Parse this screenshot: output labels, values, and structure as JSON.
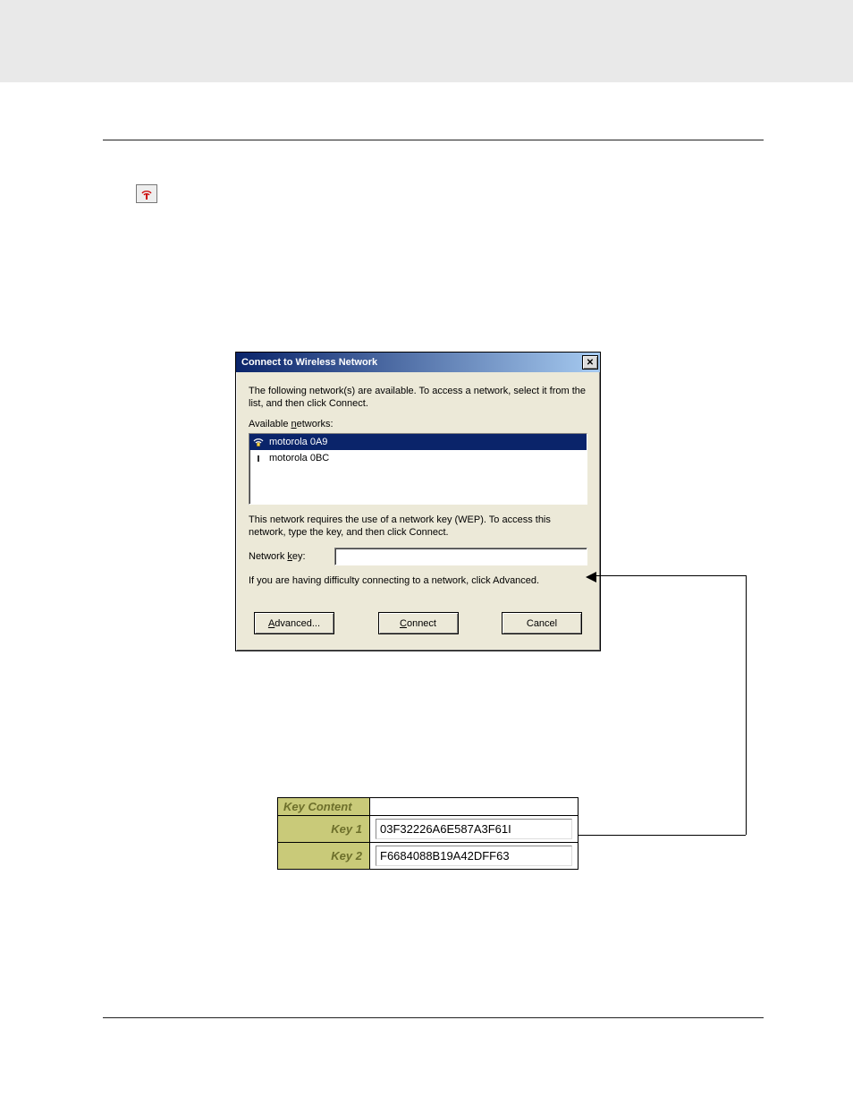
{
  "dialog": {
    "title": "Connect to Wireless Network",
    "intro": "The following network(s) are available. To access a network, select it from the list, and then click Connect.",
    "available_label": "Available networks:",
    "networks": [
      {
        "name": "motorola 0A9",
        "selected": true,
        "secure": true
      },
      {
        "name": "motorola 0BC",
        "selected": false,
        "secure": false
      }
    ],
    "wep_note": "This network requires the use of a network key (WEP). To access this network, type the key, and then click Connect.",
    "key_label": "Network key:",
    "key_value": "",
    "advanced_note": "If you are having difficulty connecting to a network, click Advanced.",
    "buttons": {
      "advanced": "Advanced...",
      "connect": "Connect",
      "cancel": "Cancel"
    },
    "underline": {
      "advanced": "A",
      "connect": "C",
      "networks": "n",
      "key": "k"
    }
  },
  "keytable": {
    "header": "Key Content",
    "rows": [
      {
        "label": "Key 1",
        "value": "03F32226A6E587A3F61I"
      },
      {
        "label": "Key 2",
        "value": "F6684088B19A42DFF63"
      }
    ]
  }
}
